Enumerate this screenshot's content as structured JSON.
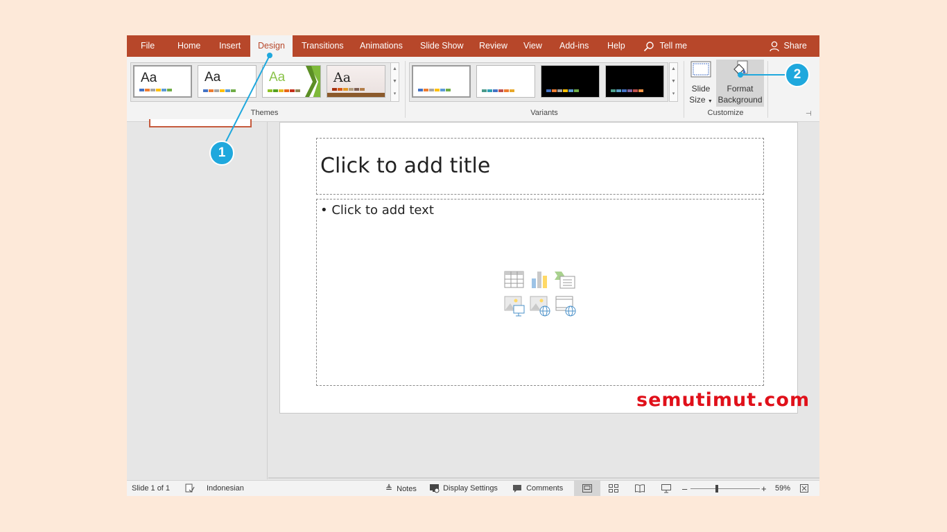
{
  "tabs": [
    "File",
    "Home",
    "Insert",
    "Design",
    "Transitions",
    "Animations",
    "Slide Show",
    "Review",
    "View",
    "Add-ins",
    "Help"
  ],
  "active_tab": "Design",
  "tell_me": "Tell me",
  "share": "Share",
  "ribbon": {
    "themes_label": "Themes",
    "variants_label": "Variants",
    "customize_label": "Customize",
    "theme_aa": "Aa",
    "slide_size": {
      "line1": "Slide",
      "line2": "Size"
    },
    "format_background": {
      "line1": "Format",
      "line2": "Background"
    }
  },
  "slide": {
    "title_placeholder": "Click to add title",
    "body_placeholder": "Click to add text"
  },
  "status": {
    "slide_info": "Slide 1 of 1",
    "language": "Indonesian",
    "notes": "Notes",
    "display_settings": "Display Settings",
    "comments": "Comments",
    "zoom": "59%"
  },
  "zoom_level_fraction": 0.38,
  "callouts": {
    "one": "1",
    "two": "2"
  },
  "watermark": "semutimut.com",
  "colors": {
    "accent": "#b7472a",
    "callout": "#1fa8dd",
    "watermark": "#e0101a"
  }
}
